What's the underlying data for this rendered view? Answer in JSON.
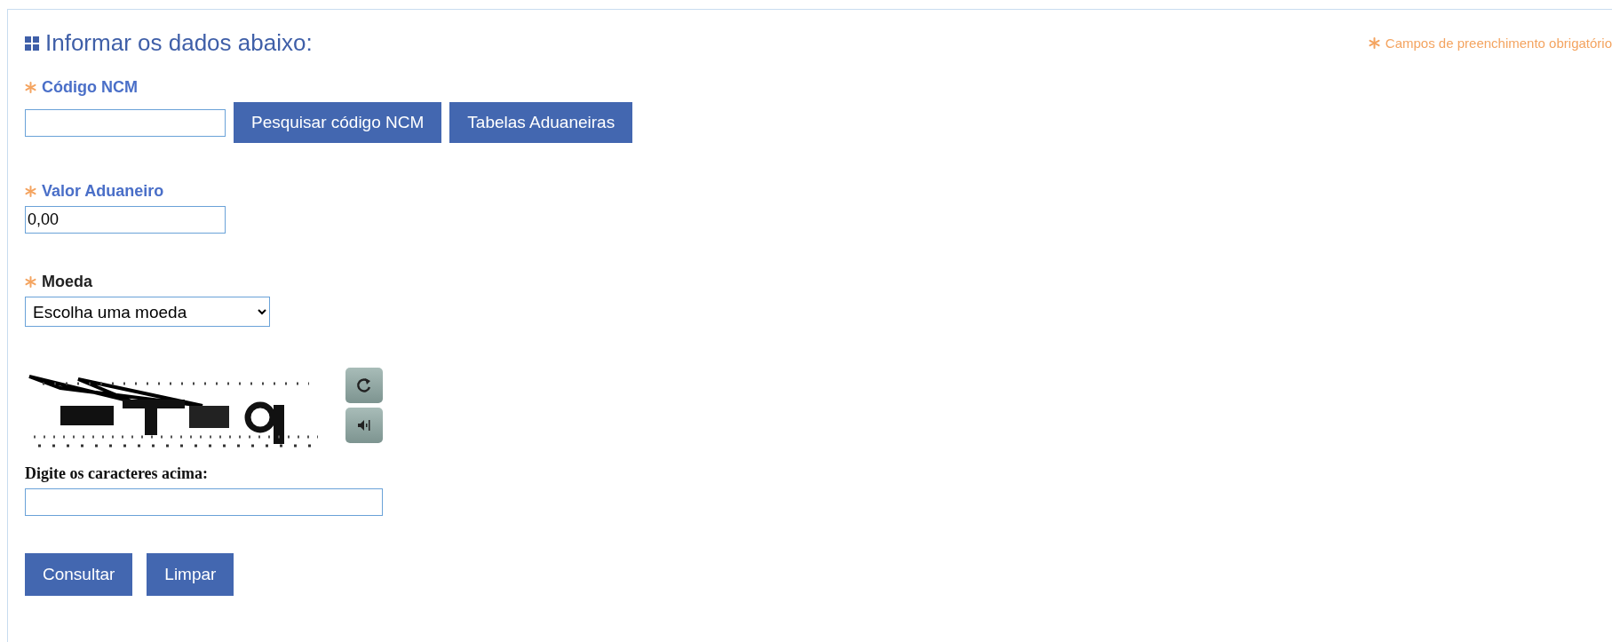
{
  "panel": {
    "title": "Informar os dados abaixo:",
    "required_note": "Campos de preenchimento obrigatório"
  },
  "fields": [
    {
      "kind": "text",
      "label": "Código NCM",
      "required": true,
      "buttons": [
        "Pesquisar código NCM",
        "Tabelas Aduaneiras"
      ]
    },
    {
      "kind": "text",
      "label": "Valor Aduaneiro",
      "required": true,
      "value": "0,00"
    },
    {
      "kind": "select",
      "label": "Moeda",
      "required": true,
      "value": "Escolha uma moeda"
    }
  ],
  "captcha": {
    "label": "Digite os caracteres acima:"
  },
  "actions": [
    "Consultar",
    "Limpar"
  ]
}
